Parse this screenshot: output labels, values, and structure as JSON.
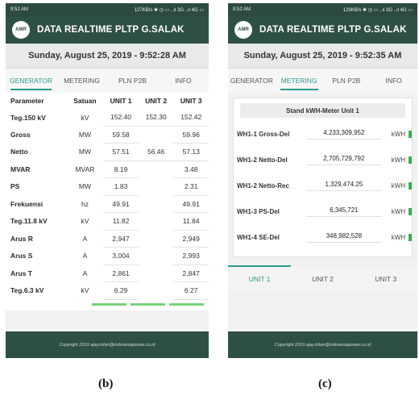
{
  "phone_b": {
    "status": {
      "time": "9:52 AM",
      "indicators": "127KB/s ✱ ◷ ▭ ..ıl 3G ..ıl 4G ▭"
    },
    "app_title": "DATA REALTIME PLTP G.SALAK",
    "logo_text": "AMR",
    "date": "Sunday, August 25, 2019 - 9:52:28 AM",
    "tabs": [
      {
        "label": "GENERATOR",
        "active": true
      },
      {
        "label": "METERING",
        "active": false
      },
      {
        "label": "PLN P2B",
        "active": false
      },
      {
        "label": "INFO",
        "active": false
      }
    ],
    "table": {
      "headers": [
        "Parameter",
        "Satuan",
        "UNIT 1",
        "UNIT 2",
        "UNIT 3"
      ],
      "rows": [
        [
          "Teg.150 kV",
          "kV",
          "152.40",
          "152.30",
          "152.42"
        ],
        [
          "Gross",
          "MW",
          "59.58",
          "",
          "59.96"
        ],
        [
          "Netto",
          "MW",
          "57.51",
          "56.46",
          "57.13"
        ],
        [
          "MVAR",
          "MVAR",
          "8.19",
          "",
          "3.48"
        ],
        [
          "PS",
          "MW",
          "1.83",
          "",
          "2.31"
        ],
        [
          "Frekuensi",
          "hz",
          "49.91",
          "",
          "49.91"
        ],
        [
          "Teg.11.8 kV",
          "kV",
          "11.82",
          "",
          "11.84"
        ],
        [
          "Arus R",
          "A",
          "2,947",
          "",
          "2,949"
        ],
        [
          "Arus S",
          "A",
          "3,004",
          "",
          "2,993"
        ],
        [
          "Arus T",
          "A",
          "2,861",
          "",
          "2,847"
        ],
        [
          "Teg.6.3 kV",
          "kV",
          "6.29",
          "",
          "6.27"
        ]
      ]
    },
    "footer": "Copyright 2019 ajay.irdan@indonesiapower.co.id"
  },
  "phone_c": {
    "status": {
      "time": "9:52 AM",
      "indicators": "129KB/s ✱ ◷ ▭ ..ıl 3G ..ıl 4G ▭"
    },
    "app_title": "DATA REALTIME PLTP G.SALAK",
    "logo_text": "AMR",
    "date": "Sunday, August 25, 2019 - 9:52:35 AM",
    "tabs": [
      {
        "label": "GENERATOR",
        "active": false
      },
      {
        "label": "METERING",
        "active": true
      },
      {
        "label": "PLN P2B",
        "active": false
      },
      {
        "label": "INFO",
        "active": false
      }
    ],
    "card_title": "Stand kWH-Meter Unit 1",
    "meters": [
      {
        "label": "WH1-1 Gross-Del",
        "value": "4,233,309,952",
        "unit": "kWH"
      },
      {
        "label": "WH1-2 Netto-Del",
        "value": "2,705,729,792",
        "unit": "kWH"
      },
      {
        "label": "WH1-2 Netto-Rec",
        "value": "1,329,474.25",
        "unit": "kWH"
      },
      {
        "label": "WH1-3 PS-Del",
        "value": "6,345,721",
        "unit": "kWH"
      },
      {
        "label": "WH1-4 SE-Del",
        "value": "348,982,528",
        "unit": "kWH"
      }
    ],
    "unit_tabs": [
      {
        "label": "UNIT 1",
        "active": true
      },
      {
        "label": "UNIT 2",
        "active": false
      },
      {
        "label": "UNIT 3",
        "active": false
      }
    ],
    "footer": "Copyright 2019 ajay.irdan@indonesiapower.co.id"
  },
  "captions": {
    "b": "(b)",
    "c": "(c)"
  },
  "colors": {
    "appbar": "#2e4f44",
    "accent": "#2a9a8a",
    "meter_bar": "#2fb34a"
  }
}
